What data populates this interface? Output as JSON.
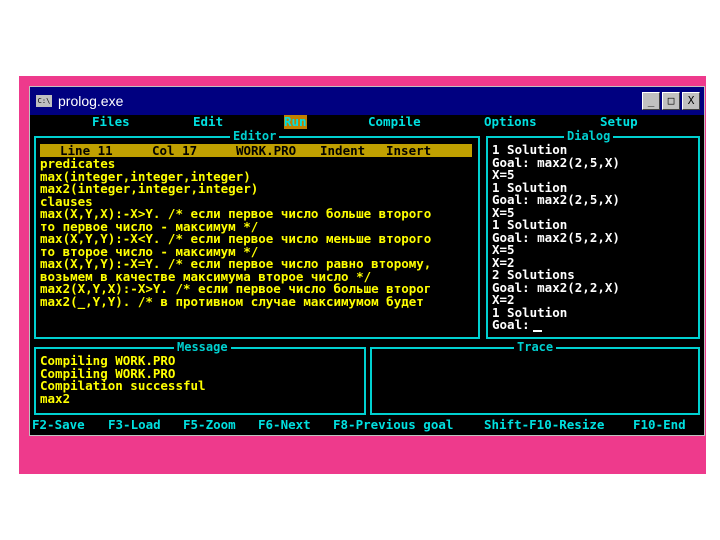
{
  "window": {
    "title": "prolog.exe",
    "icon_label": "C:\\",
    "buttons": [
      "_",
      "□",
      "X"
    ]
  },
  "menu": [
    "Files",
    "Edit",
    "Run",
    "Compile",
    "Options",
    "Setup"
  ],
  "editor": {
    "title": "Editor",
    "status": {
      "line": "Line 11",
      "col": "Col 17",
      "file": "WORK.PRO",
      "indent": "Indent",
      "insert": "Insert"
    },
    "lines": [
      "predicates",
      "max(integer,integer,integer)",
      "max2(integer,integer,integer)",
      "clauses",
      "max(X,Y,X):-X>Y. /* если первое число больше второго",
      "то первое число - максимум */",
      "max(X,Y,Y):-X<Y. /* если первое число меньше второго",
      "то второе число - максимум */",
      "max(X,Y,Y):-X=Y. /* если первое число равно второму,",
      "возьмем в качестве максимума второе число */",
      "max2(X,Y,X):-X>Y. /* если первое число больше второг",
      "max2(_,Y,Y). /* в противном случае максимумом будет"
    ]
  },
  "dialog": {
    "title": "Dialog",
    "lines": [
      "1 Solution",
      "Goal: max2(2,5,X)",
      "X=5",
      "1 Solution",
      "Goal: max2(2,5,X)",
      "X=5",
      "1 Solution",
      "Goal: max2(5,2,X)",
      "X=5",
      "X=2",
      "2 Solutions",
      "Goal: max2(2,2,X)",
      "X=2",
      "1 Solution",
      "Goal:"
    ]
  },
  "message": {
    "title": "Message",
    "lines": [
      "Compiling WORK.PRO",
      "Compiling WORK.PRO",
      "Compilation successful",
      "max2"
    ]
  },
  "trace": {
    "title": "Trace"
  },
  "fkeys": [
    "F2-Save",
    "F3-Load",
    "F5-Zoom",
    "F6-Next",
    "F8-Previous goal",
    "Shift-F10-Resize",
    "F10-End"
  ]
}
